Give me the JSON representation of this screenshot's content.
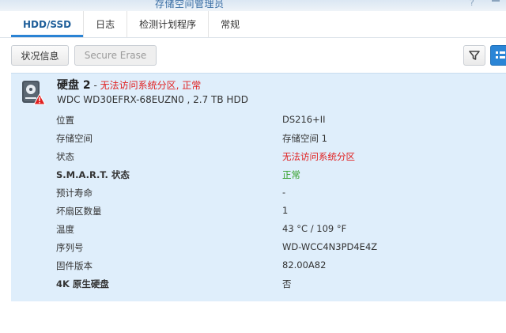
{
  "window": {
    "title": "存储空间管理员",
    "help_glyph": "?",
    "help_icon": "help-icon",
    "minimize_icon": "minimize-icon"
  },
  "tabs": [
    {
      "label": "HDD/SSD",
      "active": true
    },
    {
      "label": "日志",
      "active": false
    },
    {
      "label": "检测计划程序",
      "active": false
    },
    {
      "label": "常规",
      "active": false
    }
  ],
  "toolbar": {
    "status_label": "状况信息",
    "secure_erase_label": "Secure Erase",
    "filter_icon": "filter-icon",
    "view_icon": "grid-view-icon"
  },
  "disk": {
    "name": "硬盘 2",
    "separator": " - ",
    "alert": "无法访问系统分区, 正常",
    "model": "WDC WD30EFRX-68EUZN0 , 2.7 TB HDD",
    "icon": "hdd-warning-icon"
  },
  "details": [
    {
      "key": "位置",
      "value": "DS216+II",
      "key_bold": false,
      "status": "normal"
    },
    {
      "key": "存储空间",
      "value": "存储空间 1",
      "key_bold": false,
      "status": "normal"
    },
    {
      "key": "状态",
      "value": "无法访问系统分区",
      "key_bold": false,
      "status": "error"
    },
    {
      "key": "S.M.A.R.T. 状态",
      "value": "正常",
      "key_bold": true,
      "status": "ok"
    },
    {
      "key": "预计寿命",
      "value": "-",
      "key_bold": false,
      "status": "normal"
    },
    {
      "key": "坏扇区数量",
      "value": "1",
      "key_bold": false,
      "status": "normal"
    },
    {
      "key": "温度",
      "value": "43 °C / 109 °F",
      "key_bold": false,
      "status": "normal"
    },
    {
      "key": "序列号",
      "value": "WD-WCC4N3PD4E4Z",
      "key_bold": false,
      "status": "normal"
    },
    {
      "key": "固件版本",
      "value": "82.00A82",
      "key_bold": false,
      "status": "normal"
    },
    {
      "key": "4K 原生硬盘",
      "value": "否",
      "key_bold": true,
      "status": "normal"
    }
  ],
  "colors": {
    "accent": "#2b85d6",
    "error": "#e02020",
    "ok": "#2e9e22",
    "panel": "#dfeefb"
  }
}
